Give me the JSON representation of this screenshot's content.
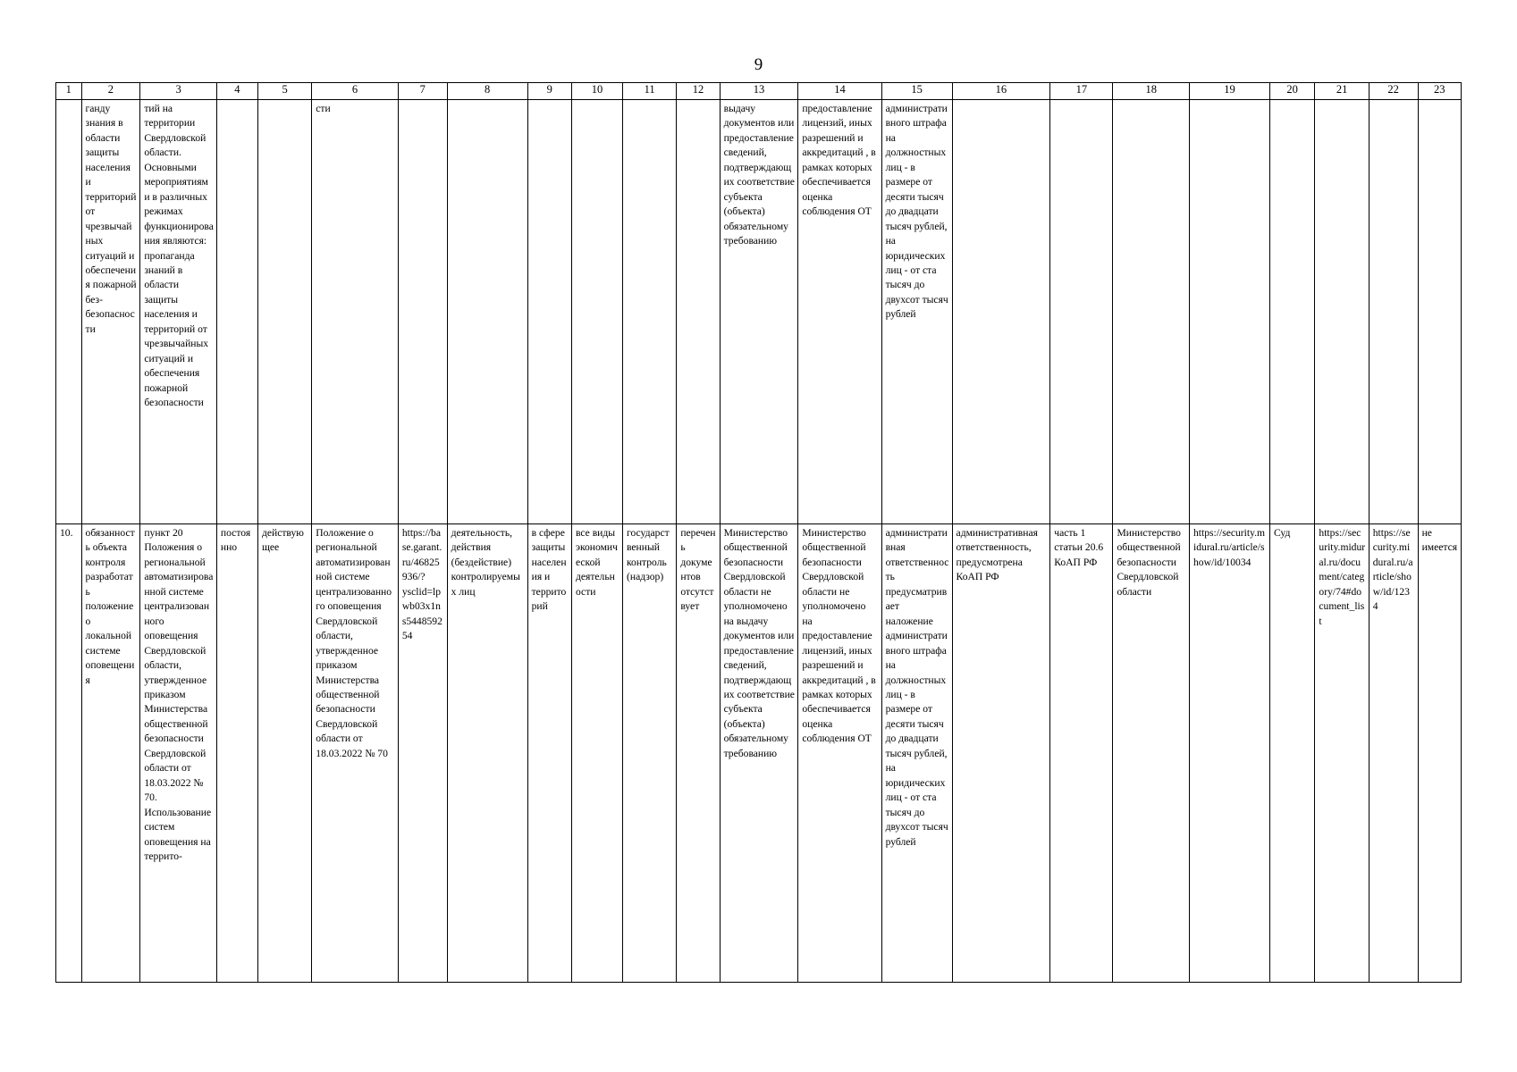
{
  "page": {
    "number": "9"
  },
  "table": {
    "column_headers": [
      "1",
      "2",
      "3",
      "4",
      "5",
      "6",
      "7",
      "8",
      "9",
      "10",
      "11",
      "12",
      "13",
      "14",
      "15",
      "16",
      "17",
      "18",
      "19",
      "20",
      "21",
      "22",
      "23"
    ],
    "rows": [
      {
        "name": "continuation-row",
        "cells": {
          "c1": "",
          "c2": "ганду знания в области защиты населения и территорий от чрезвычайных ситуаций и обеспечения пожарной без-безопасности",
          "c3": "тий на территории Свердловской области. Основными мероприятиями в различных режимах функционирования являются: пропаганда знаний в области защиты населения и территорий от чрезвычайных ситуаций и обеспечения пожарной безопасности",
          "c4": "",
          "c5": "",
          "c6": "сти",
          "c7": "",
          "c8": "",
          "c9": "",
          "c10": "",
          "c11": "",
          "c12": "",
          "c13": "выдачу документов или предоставление сведений, подтверждающих соответствие субъекта (объекта) обязательному требованию",
          "c14": "предоставление лицензий, иных разрешений и аккредитаций , в рамках которых обеспечивается оценка соблюдения ОТ",
          "c15": "административного штрафа на должностных лиц - в размере от десяти тысяч до двадцати тысяч рублей, на юридических лиц - от ста тысяч до двухсот тысяч рублей",
          "c16": "",
          "c17": "",
          "c18": "",
          "c19": "",
          "c20": "",
          "c21": "",
          "c22": "",
          "c23": ""
        }
      },
      {
        "name": "item-10-row",
        "cells": {
          "c1": "10.",
          "c2": "обязанность объекта контроля разработать положение о локальной системе оповещения",
          "c3": "пункт 20 Положения о региональной автоматизированной системе централизованного оповещения Свердловской области, утвержденное приказом Министерства общественной безопасности Свердловской области от 18.03.2022 № 70. Использование систем оповещения на террито-",
          "c4": "постоянно",
          "c5": "действующее",
          "c6": "Положение о региональной автоматизированной системе централизованного оповещения Свердловской области, утвержденное приказом Министерства общественной безопасности Свердловской области от 18.03.2022 № 70",
          "c7": "https://base.garant.ru/46825936/?ysclid=lpwb03x1ns544859254",
          "c8": "деятельность, действия (бездействие) контролируемых лиц",
          "c9": "в сфере защиты населения и территорий",
          "c10": "все виды экономической деятельности",
          "c11": "государственный контроль (надзор)",
          "c12": "перечень документов отсутствует",
          "c13": "Министерство общественной безопасности Свердловской области не уполномочено на выдачу документов или предоставление сведений, подтверждающих соответствие субъекта (объекта) обязательному требованию",
          "c14": "Министерство общественной безопасности Свердловской области не уполномочено на предоставление лицензий, иных разрешений и аккредитаций , в рамках которых обеспечивается оценка соблюдения ОТ",
          "c15": "административная ответственность предусматривает наложение административного штрафа на должностных лиц - в размере от десяти тысяч до двадцати тысяч рублей, на юридических лиц - от ста тысяч до двухсот тысяч рублей",
          "c16": "административная ответственность, предусмотрена КоАП РФ",
          "c17": "часть 1 статьи 20.6 КоАП РФ",
          "c18": "Министерство общественной безопасности Свердловской области",
          "c19": "https://security.midural.ru/article/show/id/10034",
          "c20": "Суд",
          "c21": "https://security.midural.ru/document/category/74#document_list",
          "c22": "https://security.midural.ru/article/show/id/1234",
          "c23": "не имеется"
        }
      }
    ]
  }
}
